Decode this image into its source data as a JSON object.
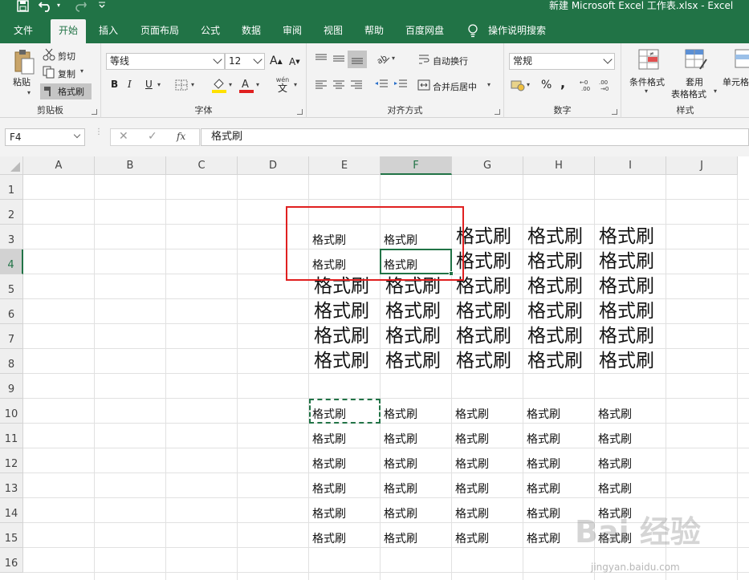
{
  "window": {
    "title": "新建 Microsoft Excel 工作表.xlsx  -  Excel"
  },
  "tabs": [
    "文件",
    "开始",
    "插入",
    "页面布局",
    "公式",
    "数据",
    "审阅",
    "视图",
    "帮助",
    "百度网盘",
    "操作说明搜索"
  ],
  "ribbon": {
    "clipboard": {
      "paste": "粘贴",
      "cut": "剪切",
      "copy": "复制",
      "format_painter": "格式刷",
      "label": "剪贴板"
    },
    "font": {
      "name": "等线",
      "size": "12",
      "bold": "B",
      "italic": "I",
      "underline": "U",
      "label": "字体",
      "wen": "wén",
      "wen_char": "文"
    },
    "alignment": {
      "wrap_text": "自动换行",
      "merge_center": "合并后居中",
      "label": "对齐方式"
    },
    "number": {
      "format": "常规",
      "percent": "%",
      "comma": ",",
      "label": "数字"
    },
    "styles": {
      "conditional": "条件格式",
      "table_l1": "套用",
      "table_l2": "表格格式",
      "cell_styles": "单元格",
      "label": "样式"
    }
  },
  "formula_bar": {
    "name_box": "F4",
    "fx": "fx",
    "cancel": "✕",
    "enter": "✓",
    "content": "格式刷"
  },
  "sheet": {
    "columns": [
      "A",
      "B",
      "C",
      "D",
      "E",
      "F",
      "G",
      "H",
      "I",
      "J"
    ],
    "selected_column": "F",
    "selected_row": 4,
    "rows": [
      1,
      2,
      3,
      4,
      5,
      6,
      7,
      8,
      9,
      10,
      11,
      12,
      13,
      14,
      15,
      16
    ],
    "cells": [
      {
        "ref": "E3",
        "text": "格式刷",
        "size": "small"
      },
      {
        "ref": "F3",
        "text": "格式刷",
        "size": "small"
      },
      {
        "ref": "G3",
        "text": "格式刷",
        "size": "big"
      },
      {
        "ref": "H3",
        "text": "格式刷",
        "size": "big"
      },
      {
        "ref": "I3",
        "text": "格式刷",
        "size": "big"
      },
      {
        "ref": "E4",
        "text": "格式刷",
        "size": "small"
      },
      {
        "ref": "F4",
        "text": "格式刷",
        "size": "small"
      },
      {
        "ref": "G4",
        "text": "格式刷",
        "size": "big"
      },
      {
        "ref": "H4",
        "text": "格式刷",
        "size": "big"
      },
      {
        "ref": "I4",
        "text": "格式刷",
        "size": "big"
      },
      {
        "ref": "E5",
        "text": "格式刷",
        "size": "big"
      },
      {
        "ref": "F5",
        "text": "格式刷",
        "size": "big"
      },
      {
        "ref": "G5",
        "text": "格式刷",
        "size": "big"
      },
      {
        "ref": "H5",
        "text": "格式刷",
        "size": "big"
      },
      {
        "ref": "I5",
        "text": "格式刷",
        "size": "big"
      },
      {
        "ref": "E6",
        "text": "格式刷",
        "size": "big"
      },
      {
        "ref": "F6",
        "text": "格式刷",
        "size": "big"
      },
      {
        "ref": "G6",
        "text": "格式刷",
        "size": "big"
      },
      {
        "ref": "H6",
        "text": "格式刷",
        "size": "big"
      },
      {
        "ref": "I6",
        "text": "格式刷",
        "size": "big"
      },
      {
        "ref": "E7",
        "text": "格式刷",
        "size": "big"
      },
      {
        "ref": "F7",
        "text": "格式刷",
        "size": "big"
      },
      {
        "ref": "G7",
        "text": "格式刷",
        "size": "big"
      },
      {
        "ref": "H7",
        "text": "格式刷",
        "size": "big"
      },
      {
        "ref": "I7",
        "text": "格式刷",
        "size": "big"
      },
      {
        "ref": "E8",
        "text": "格式刷",
        "size": "big"
      },
      {
        "ref": "F8",
        "text": "格式刷",
        "size": "big"
      },
      {
        "ref": "G8",
        "text": "格式刷",
        "size": "big"
      },
      {
        "ref": "H8",
        "text": "格式刷",
        "size": "big"
      },
      {
        "ref": "I8",
        "text": "格式刷",
        "size": "big"
      },
      {
        "ref": "E10",
        "text": "格式刷",
        "size": "small"
      },
      {
        "ref": "F10",
        "text": "格式刷",
        "size": "small"
      },
      {
        "ref": "G10",
        "text": "格式刷",
        "size": "small"
      },
      {
        "ref": "H10",
        "text": "格式刷",
        "size": "small"
      },
      {
        "ref": "I10",
        "text": "格式刷",
        "size": "small"
      },
      {
        "ref": "E11",
        "text": "格式刷",
        "size": "small"
      },
      {
        "ref": "F11",
        "text": "格式刷",
        "size": "small"
      },
      {
        "ref": "G11",
        "text": "格式刷",
        "size": "small"
      },
      {
        "ref": "H11",
        "text": "格式刷",
        "size": "small"
      },
      {
        "ref": "I11",
        "text": "格式刷",
        "size": "small"
      },
      {
        "ref": "E12",
        "text": "格式刷",
        "size": "small"
      },
      {
        "ref": "F12",
        "text": "格式刷",
        "size": "small"
      },
      {
        "ref": "G12",
        "text": "格式刷",
        "size": "small"
      },
      {
        "ref": "H12",
        "text": "格式刷",
        "size": "small"
      },
      {
        "ref": "I12",
        "text": "格式刷",
        "size": "small"
      },
      {
        "ref": "E13",
        "text": "格式刷",
        "size": "small"
      },
      {
        "ref": "F13",
        "text": "格式刷",
        "size": "small"
      },
      {
        "ref": "G13",
        "text": "格式刷",
        "size": "small"
      },
      {
        "ref": "H13",
        "text": "格式刷",
        "size": "small"
      },
      {
        "ref": "I13",
        "text": "格式刷",
        "size": "small"
      },
      {
        "ref": "E14",
        "text": "格式刷",
        "size": "small"
      },
      {
        "ref": "F14",
        "text": "格式刷",
        "size": "small"
      },
      {
        "ref": "G14",
        "text": "格式刷",
        "size": "small"
      },
      {
        "ref": "H14",
        "text": "格式刷",
        "size": "small"
      },
      {
        "ref": "I14",
        "text": "格式刷",
        "size": "small"
      },
      {
        "ref": "E15",
        "text": "格式刷",
        "size": "small"
      },
      {
        "ref": "F15",
        "text": "格式刷",
        "size": "small"
      },
      {
        "ref": "G15",
        "text": "格式刷",
        "size": "small"
      },
      {
        "ref": "H15",
        "text": "格式刷",
        "size": "small"
      },
      {
        "ref": "I15",
        "text": "格式刷",
        "size": "small"
      }
    ]
  },
  "colors": {
    "excel_green": "#217346",
    "highlight_box": "#e02020",
    "fill_yellow": "#ffe100",
    "font_red": "#e02020"
  },
  "watermark": {
    "text": "Bai 经验",
    "url": "jingyan.baidu.com"
  }
}
